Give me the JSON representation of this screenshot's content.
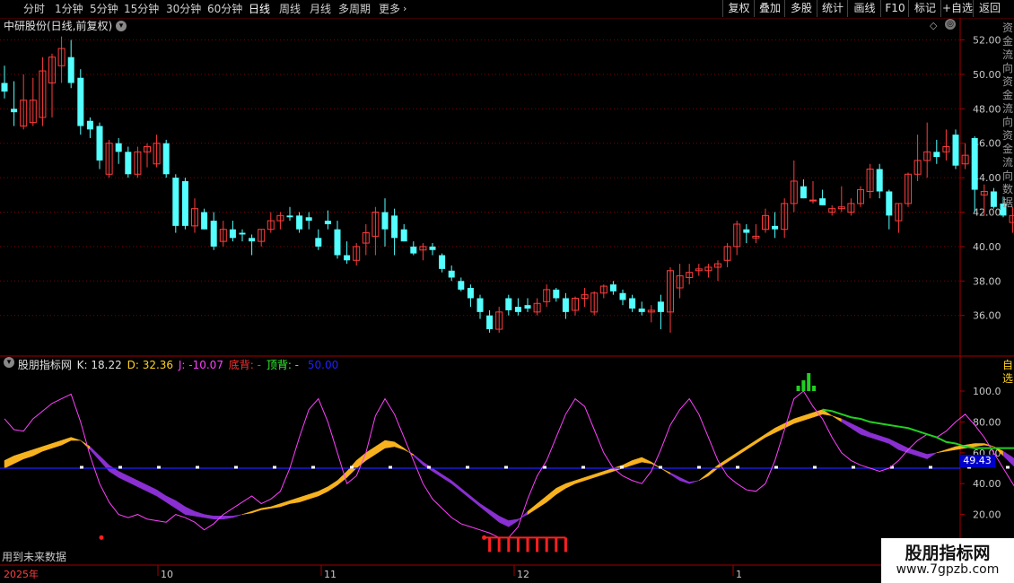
{
  "toolbar": {
    "periods": [
      "分时",
      "1分钟",
      "5分钟",
      "15分钟",
      "30分钟",
      "60分钟",
      "日线",
      "周线",
      "月线",
      "多周期",
      "更多"
    ],
    "active_period": "日线",
    "right_buttons": [
      "复权",
      "叠加",
      "多股",
      "统计",
      "画线",
      "F10",
      "标记",
      "+自选",
      "返回"
    ]
  },
  "stock_title": "中研股份(日线,前复权)",
  "indicator": {
    "name": "股朋指标网",
    "k": "K: 18.22",
    "d": "D: 32.36",
    "j": "J: -10.07",
    "bottom_div": "底背: -",
    "top_div": "顶背: -",
    "mid": "50.00",
    "mid_value": "49.43"
  },
  "future_note": "用到未来数据",
  "time_axis": {
    "year_label": "2025年",
    "months": [
      "10",
      "11",
      "12",
      "1"
    ]
  },
  "price_axis": [
    "52.00",
    "50.00",
    "48.00",
    "46.00",
    "44.00",
    "42.00",
    "40.00",
    "38.00",
    "36.00"
  ],
  "ind_axis": [
    "100.0",
    "80.00",
    "60.00",
    "40.00",
    "20.00"
  ],
  "watermark": {
    "title": "股朋指标网",
    "url": "www.7gpzb.com"
  },
  "colors": {
    "up": "#ff3c3c",
    "down": "#54ffff",
    "k_band_up": "#f7b21e",
    "k_band_down": "#8a2fd1",
    "j_line": "#ff40ff",
    "mid_line": "#2020ff",
    "top_line": "#22d022"
  },
  "chart_data": {
    "type": "candlestick",
    "ylim": [
      34,
      53
    ],
    "ohlc": [
      [
        49.5,
        50.5,
        48.6,
        49.0
      ],
      [
        48.0,
        49.6,
        47.0,
        47.8
      ],
      [
        47.0,
        50.0,
        46.8,
        48.5
      ],
      [
        47.2,
        49.8,
        47.0,
        48.5
      ],
      [
        47.5,
        51.0,
        47.0,
        50.2
      ],
      [
        49.5,
        51.2,
        47.5,
        51.0
      ],
      [
        50.5,
        52.2,
        49.5,
        51.5
      ],
      [
        51.0,
        52.0,
        49.2,
        49.5
      ],
      [
        49.8,
        50.3,
        46.5,
        47.0
      ],
      [
        47.3,
        47.5,
        46.3,
        46.8
      ],
      [
        47.0,
        47.2,
        44.5,
        45.0
      ],
      [
        44.2,
        46.2,
        44.0,
        46.0
      ],
      [
        46.0,
        46.3,
        44.8,
        45.5
      ],
      [
        45.5,
        45.8,
        44.0,
        44.2
      ],
      [
        44.2,
        45.8,
        44.0,
        45.5
      ],
      [
        45.5,
        46.0,
        44.6,
        45.8
      ],
      [
        44.8,
        46.5,
        44.6,
        46.0
      ],
      [
        46.0,
        46.2,
        44.0,
        44.2
      ],
      [
        44.0,
        44.2,
        40.8,
        41.2
      ],
      [
        43.8,
        44.0,
        41.0,
        41.2
      ],
      [
        41.2,
        42.8,
        40.8,
        42.2
      ],
      [
        42.0,
        42.2,
        41.0,
        41.0
      ],
      [
        41.5,
        42.0,
        39.8,
        40.0
      ],
      [
        40.3,
        41.5,
        40.0,
        41.0
      ],
      [
        41.0,
        41.5,
        40.3,
        40.5
      ],
      [
        40.8,
        41.0,
        40.3,
        40.7
      ],
      [
        40.5,
        40.7,
        39.5,
        40.3
      ],
      [
        40.3,
        41.0,
        40.0,
        41.0
      ],
      [
        41.0,
        42.0,
        40.8,
        41.5
      ],
      [
        41.5,
        42.0,
        41.0,
        41.8
      ],
      [
        41.8,
        42.3,
        41.5,
        41.7
      ],
      [
        41.8,
        42.0,
        40.8,
        41.0
      ],
      [
        41.7,
        42.0,
        41.0,
        41.5
      ],
      [
        40.5,
        41.0,
        39.8,
        40.0
      ],
      [
        41.5,
        42.1,
        41.0,
        41.3
      ],
      [
        41.0,
        41.5,
        39.3,
        39.5
      ],
      [
        39.5,
        40.3,
        39.0,
        39.2
      ],
      [
        39.2,
        40.2,
        38.9,
        40.0
      ],
      [
        40.2,
        41.3,
        39.5,
        40.8
      ],
      [
        40.6,
        42.3,
        39.5,
        42.0
      ],
      [
        42.0,
        42.8,
        40.0,
        41.0
      ],
      [
        41.8,
        42.2,
        39.5,
        40.5
      ],
      [
        41.0,
        41.3,
        40.3,
        40.3
      ],
      [
        40.0,
        40.3,
        39.5,
        39.6
      ],
      [
        39.8,
        40.2,
        39.2,
        40.0
      ],
      [
        40.0,
        40.2,
        39.5,
        39.8
      ],
      [
        39.5,
        39.6,
        38.5,
        38.7
      ],
      [
        38.6,
        38.9,
        38.0,
        38.2
      ],
      [
        38.0,
        38.2,
        37.4,
        37.5
      ],
      [
        37.6,
        37.8,
        36.5,
        37.0
      ],
      [
        37.0,
        37.2,
        35.8,
        36.2
      ],
      [
        36.0,
        36.3,
        35.0,
        35.2
      ],
      [
        35.2,
        36.5,
        35.0,
        36.2
      ],
      [
        37.0,
        37.2,
        36.0,
        36.3
      ],
      [
        36.5,
        37.0,
        36.0,
        36.2
      ],
      [
        36.6,
        37.0,
        36.2,
        36.4
      ],
      [
        36.2,
        37.0,
        36.0,
        36.7
      ],
      [
        36.8,
        37.8,
        36.5,
        37.5
      ],
      [
        37.5,
        37.6,
        36.8,
        37.0
      ],
      [
        37.0,
        37.3,
        35.8,
        36.2
      ],
      [
        36.3,
        37.1,
        36.0,
        37.0
      ],
      [
        37.0,
        37.6,
        36.5,
        37.2
      ],
      [
        36.2,
        37.4,
        36.0,
        37.3
      ],
      [
        37.3,
        37.8,
        37.0,
        37.7
      ],
      [
        37.8,
        38.0,
        37.2,
        37.4
      ],
      [
        37.3,
        37.5,
        36.6,
        36.9
      ],
      [
        37.0,
        37.2,
        36.2,
        36.4
      ],
      [
        36.4,
        36.8,
        36.0,
        36.2
      ],
      [
        36.2,
        36.6,
        35.6,
        36.3
      ],
      [
        36.8,
        37.2,
        35.2,
        36.2
      ],
      [
        36.2,
        38.8,
        35.0,
        38.6
      ],
      [
        37.6,
        39.0,
        37.0,
        38.3
      ],
      [
        38.2,
        39.0,
        37.8,
        38.5
      ],
      [
        38.6,
        39.0,
        38.3,
        38.7
      ],
      [
        38.6,
        39.0,
        38.2,
        38.8
      ],
      [
        38.8,
        39.2,
        38.0,
        39.0
      ],
      [
        39.2,
        40.2,
        38.8,
        40.0
      ],
      [
        40.0,
        41.5,
        39.5,
        41.3
      ],
      [
        41.0,
        41.3,
        40.2,
        40.8
      ],
      [
        40.5,
        41.3,
        40.2,
        40.6
      ],
      [
        41.0,
        42.2,
        40.8,
        41.8
      ],
      [
        41.2,
        42.0,
        40.5,
        41.0
      ],
      [
        41.0,
        42.8,
        40.5,
        42.5
      ],
      [
        42.5,
        45.0,
        42.0,
        43.8
      ],
      [
        43.5,
        43.9,
        42.8,
        42.8
      ],
      [
        42.7,
        43.8,
        42.5,
        42.7
      ],
      [
        42.8,
        43.3,
        42.4,
        42.4
      ],
      [
        42.0,
        42.4,
        41.8,
        42.2
      ],
      [
        42.2,
        43.5,
        42.0,
        42.3
      ],
      [
        42.0,
        42.8,
        41.8,
        42.5
      ],
      [
        42.5,
        43.5,
        42.3,
        43.3
      ],
      [
        43.2,
        44.8,
        42.8,
        44.5
      ],
      [
        44.5,
        44.8,
        42.8,
        43.2
      ],
      [
        43.2,
        43.3,
        41.0,
        41.8
      ],
      [
        41.5,
        42.5,
        40.8,
        42.5
      ],
      [
        42.5,
        44.3,
        42.3,
        44.2
      ],
      [
        44.2,
        46.5,
        43.8,
        45.0
      ],
      [
        45.0,
        47.2,
        44.0,
        45.5
      ],
      [
        45.5,
        46.2,
        44.8,
        45.2
      ],
      [
        45.5,
        46.8,
        45.0,
        45.8
      ],
      [
        46.5,
        46.8,
        44.5,
        44.7
      ],
      [
        44.8,
        46.0,
        44.5,
        45.3
      ],
      [
        46.3,
        46.4,
        42.0,
        43.3
      ],
      [
        43.0,
        43.6,
        41.8,
        43.2
      ],
      [
        43.2,
        43.4,
        42.2,
        42.3
      ],
      [
        42.5,
        42.9,
        41.7,
        41.8
      ],
      [
        41.4,
        42.3,
        40.8,
        41.8
      ],
      [
        41.0,
        41.7,
        38.6,
        38.4
      ]
    ],
    "kdj": {
      "k": [
        55,
        58,
        60,
        62,
        64,
        66,
        68,
        70,
        68,
        62,
        55,
        48,
        44,
        41,
        38,
        35,
        32,
        28,
        24,
        20,
        19,
        18,
        17,
        17,
        18,
        20,
        22,
        24,
        25,
        27,
        29,
        31,
        33,
        35,
        38,
        42,
        48,
        55,
        60,
        64,
        68,
        67,
        63,
        58,
        52,
        48,
        44,
        40,
        35,
        30,
        25,
        20,
        15,
        12,
        16,
        22,
        27,
        32,
        37,
        40,
        42,
        44,
        46,
        48,
        50,
        52,
        55,
        57,
        54,
        50,
        46,
        42,
        40,
        42,
        47,
        52,
        56,
        60,
        64,
        68,
        72,
        76,
        79,
        82,
        84,
        86,
        88,
        84,
        80,
        76,
        72,
        70,
        68,
        66,
        62,
        60,
        58,
        56,
        60,
        62,
        64,
        65,
        66,
        66,
        64,
        58,
        52,
        46,
        40,
        34,
        28,
        22,
        18
      ],
      "d": [
        50,
        53,
        56,
        58,
        61,
        63,
        65,
        68,
        68,
        64,
        58,
        52,
        48,
        45,
        42,
        39,
        36,
        32,
        29,
        25,
        22,
        20,
        19,
        19,
        19,
        20,
        21,
        23,
        24,
        25,
        27,
        28,
        30,
        32,
        35,
        39,
        44,
        50,
        55,
        59,
        63,
        64,
        62,
        59,
        54,
        50,
        46,
        42,
        37,
        32,
        27,
        23,
        19,
        16,
        17,
        20,
        24,
        28,
        33,
        37,
        40,
        42,
        44,
        46,
        48,
        50,
        52,
        54,
        53,
        50,
        47,
        44,
        41,
        42,
        45,
        50,
        54,
        58,
        62,
        66,
        70,
        73,
        76,
        79,
        81,
        83,
        85,
        84,
        82,
        79,
        76,
        73,
        71,
        69,
        66,
        63,
        61,
        59,
        60,
        61,
        62,
        63,
        64,
        65,
        64,
        61,
        57,
        52,
        47,
        41,
        36,
        30,
        24
      ],
      "j": [
        82,
        75,
        74,
        82,
        87,
        92,
        95,
        98,
        80,
        58,
        40,
        28,
        20,
        18,
        20,
        17,
        16,
        15,
        20,
        18,
        15,
        10,
        14,
        20,
        24,
        28,
        32,
        27,
        30,
        35,
        50,
        70,
        88,
        95,
        80,
        60,
        40,
        45,
        60,
        84,
        95,
        85,
        70,
        55,
        40,
        30,
        24,
        18,
        14,
        12,
        10,
        8,
        5,
        5,
        12,
        30,
        45,
        55,
        70,
        85,
        95,
        90,
        75,
        60,
        50,
        45,
        42,
        40,
        48,
        62,
        78,
        88,
        95,
        85,
        70,
        55,
        45,
        40,
        36,
        35,
        40,
        55,
        75,
        95,
        100,
        90,
        82,
        70,
        60,
        55,
        52,
        50,
        48,
        50,
        55,
        62,
        68,
        72,
        70,
        74,
        80,
        85,
        78,
        70,
        60,
        50,
        40,
        30,
        22,
        15,
        10,
        5,
        -10
      ]
    },
    "top_line": {
      "from": 86,
      "values": [
        88,
        87,
        85,
        83,
        82,
        80,
        79,
        78,
        77,
        76,
        74,
        72,
        70,
        67,
        66,
        64,
        63,
        63,
        63,
        63,
        63,
        63,
        63,
        63,
        63,
        63,
        63
      ]
    },
    "top_signal_index": 84,
    "bottom_signal_range": [
      51,
      59
    ]
  }
}
